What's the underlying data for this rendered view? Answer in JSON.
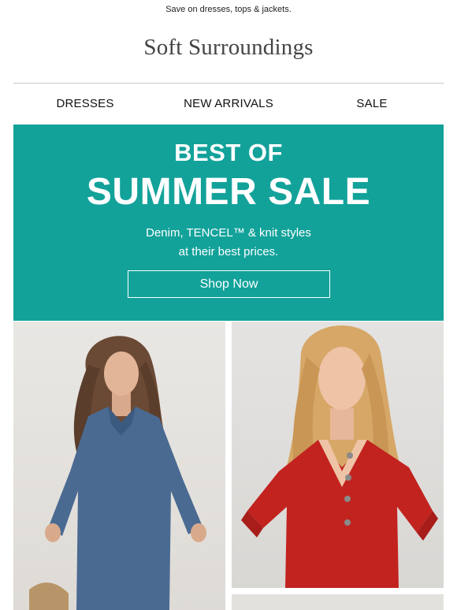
{
  "preheader": "Save on dresses, tops & jackets.",
  "brand": {
    "logo_text": "Soft Surroundings"
  },
  "nav": {
    "items": [
      "DRESSES",
      "NEW ARRIVALS",
      "SALE"
    ]
  },
  "hero": {
    "eyebrow": "BEST OF",
    "title": "SUMMER SALE",
    "subtitle_line1": "Denim, TENCEL™ & knit styles",
    "subtitle_line2": "at their best prices.",
    "cta_label": "Shop Now",
    "background_color": "#12a29a"
  },
  "photos": {
    "left_alt": "Woman in chambray denim dress",
    "right_alt": "Woman in red button henley top"
  }
}
